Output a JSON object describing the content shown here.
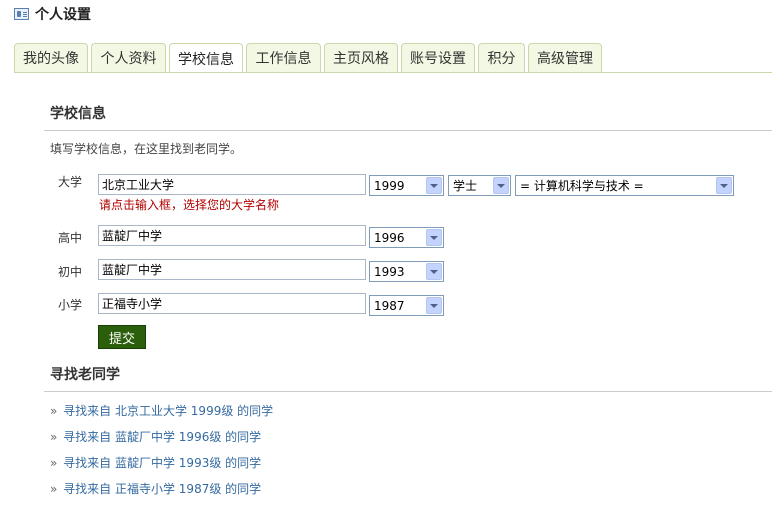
{
  "header": {
    "title": "个人设置",
    "icon": "profile-card-icon"
  },
  "tabs": [
    {
      "label": "我的头像"
    },
    {
      "label": "个人资料"
    },
    {
      "label": "学校信息",
      "active": true
    },
    {
      "label": "工作信息"
    },
    {
      "label": "主页风格"
    },
    {
      "label": "账号设置"
    },
    {
      "label": "积分"
    },
    {
      "label": "高级管理"
    }
  ],
  "school_section": {
    "title": "学校信息",
    "description": "填写学校信息，在这里找到老同学。",
    "university": {
      "label": "大学",
      "name": "北京工业大学",
      "year": "1999",
      "degree": "学士",
      "major": "= 计算机科学与技术 =",
      "hint": "请点击输入框，选择您的大学名称"
    },
    "high_school": {
      "label": "高中",
      "name": "蓝靛厂中学",
      "year": "1996"
    },
    "middle_school": {
      "label": "初中",
      "name": "蓝靛厂中学",
      "year": "1993"
    },
    "primary_school": {
      "label": "小学",
      "name": "正福寺小学",
      "year": "1987"
    },
    "submit_label": "提交"
  },
  "find_section": {
    "title": "寻找老同学",
    "links": [
      "寻找来自 北京工业大学 1999级 的同学",
      "寻找来自 蓝靛厂中学 1996级 的同学",
      "寻找来自 蓝靛厂中学 1993级 的同学",
      "寻找来自 正福寺小学 1987级 的同学"
    ],
    "link_prefix": "»"
  },
  "colors": {
    "tab_border": "#c9d9a8",
    "tab_bg": "#f3f8e4",
    "hint": "#b20000",
    "submit_bg": "#2b5f0c",
    "link": "#356aa0"
  }
}
